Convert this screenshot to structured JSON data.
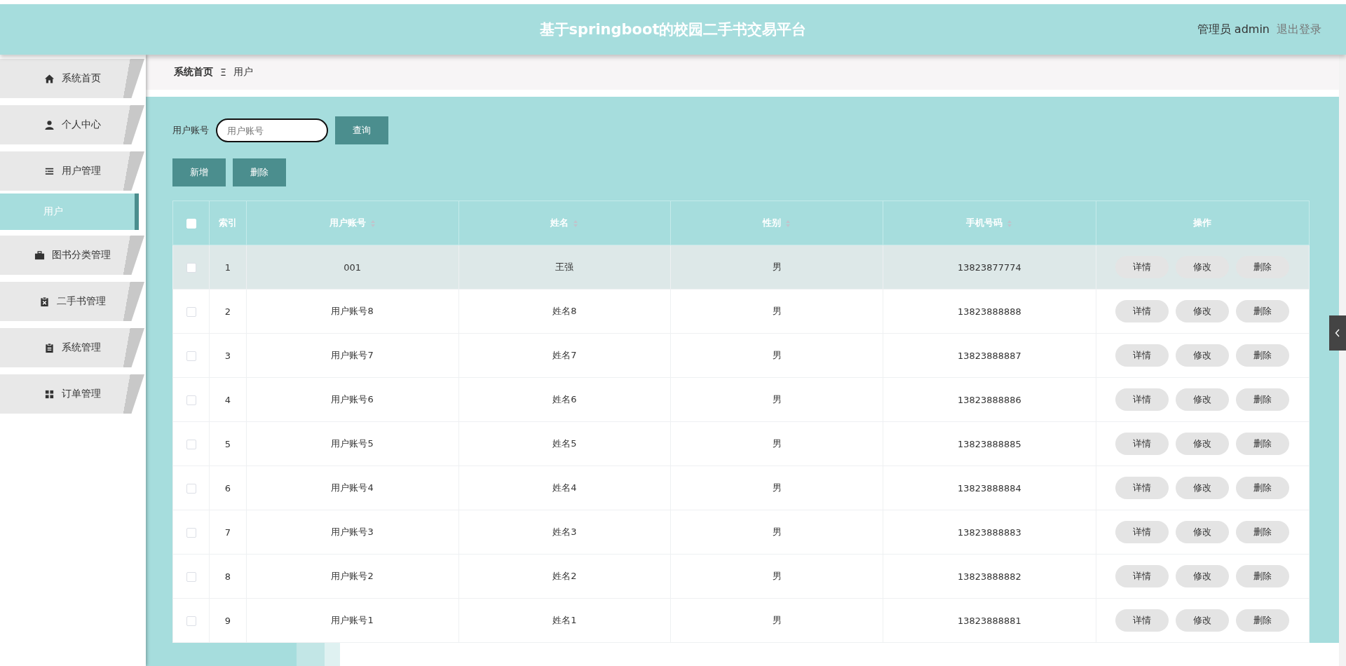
{
  "header": {
    "title": "基于springboot的校园二手书交易平台",
    "user_label": "管理员 admin",
    "logout": "退出登录"
  },
  "sidebar": {
    "items": [
      {
        "label": "系统首页",
        "selected": false
      },
      {
        "label": "个人中心",
        "selected": false
      },
      {
        "label": "用户管理",
        "selected": false,
        "children": [
          {
            "label": "用户",
            "selected": true
          }
        ]
      },
      {
        "label": "图书分类管理",
        "selected": false
      },
      {
        "label": "二手书管理",
        "selected": false
      },
      {
        "label": "系统管理",
        "selected": false
      },
      {
        "label": "订单管理",
        "selected": false
      }
    ]
  },
  "breadcrumb": {
    "items": [
      "系统首页",
      "用户"
    ],
    "separator": "Ξ"
  },
  "search": {
    "label": "用户账号",
    "placeholder": "用户账号",
    "button": "查询"
  },
  "actions": [
    "新增",
    "删除"
  ],
  "table": {
    "all_checked": false,
    "columns": [
      {
        "label": "索引",
        "sortable": false
      },
      {
        "label": "用户账号",
        "sortable": true
      },
      {
        "label": "姓名",
        "sortable": true
      },
      {
        "label": "性别",
        "sortable": true
      },
      {
        "label": "手机号码",
        "sortable": true
      },
      {
        "label": "操作",
        "sortable": false
      }
    ],
    "rows": [
      {
        "index": "1",
        "account": "001",
        "name": "王强",
        "gender": "男",
        "phone": "13823877774",
        "checked": false,
        "hovered": true,
        "actions": [
          "详情",
          "修改",
          "删除"
        ]
      },
      {
        "index": "2",
        "account": "用户账号8",
        "name": "姓名8",
        "gender": "男",
        "phone": "13823888888",
        "checked": false,
        "hovered": false,
        "actions": [
          "详情",
          "修改",
          "删除"
        ]
      },
      {
        "index": "3",
        "account": "用户账号7",
        "name": "姓名7",
        "gender": "男",
        "phone": "13823888887",
        "checked": false,
        "hovered": false,
        "actions": [
          "详情",
          "修改",
          "删除"
        ]
      },
      {
        "index": "4",
        "account": "用户账号6",
        "name": "姓名6",
        "gender": "男",
        "phone": "13823888886",
        "checked": false,
        "hovered": false,
        "actions": [
          "详情",
          "修改",
          "删除"
        ]
      },
      {
        "index": "5",
        "account": "用户账号5",
        "name": "姓名5",
        "gender": "男",
        "phone": "13823888885",
        "checked": false,
        "hovered": false,
        "actions": [
          "详情",
          "修改",
          "删除"
        ]
      },
      {
        "index": "6",
        "account": "用户账号4",
        "name": "姓名4",
        "gender": "男",
        "phone": "13823888884",
        "checked": false,
        "hovered": false,
        "actions": [
          "详情",
          "修改",
          "删除"
        ]
      },
      {
        "index": "7",
        "account": "用户账号3",
        "name": "姓名3",
        "gender": "男",
        "phone": "13823888883",
        "checked": false,
        "hovered": false,
        "actions": [
          "详情",
          "修改",
          "删除"
        ]
      },
      {
        "index": "8",
        "account": "用户账号2",
        "name": "姓名2",
        "gender": "男",
        "phone": "13823888882",
        "checked": false,
        "hovered": false,
        "actions": [
          "详情",
          "修改",
          "删除"
        ]
      },
      {
        "index": "9",
        "account": "用户账号1",
        "name": "姓名1",
        "gender": "男",
        "phone": "13823888881",
        "checked": false,
        "hovered": false,
        "actions": [
          "详情",
          "修改",
          "删除"
        ]
      }
    ]
  }
}
